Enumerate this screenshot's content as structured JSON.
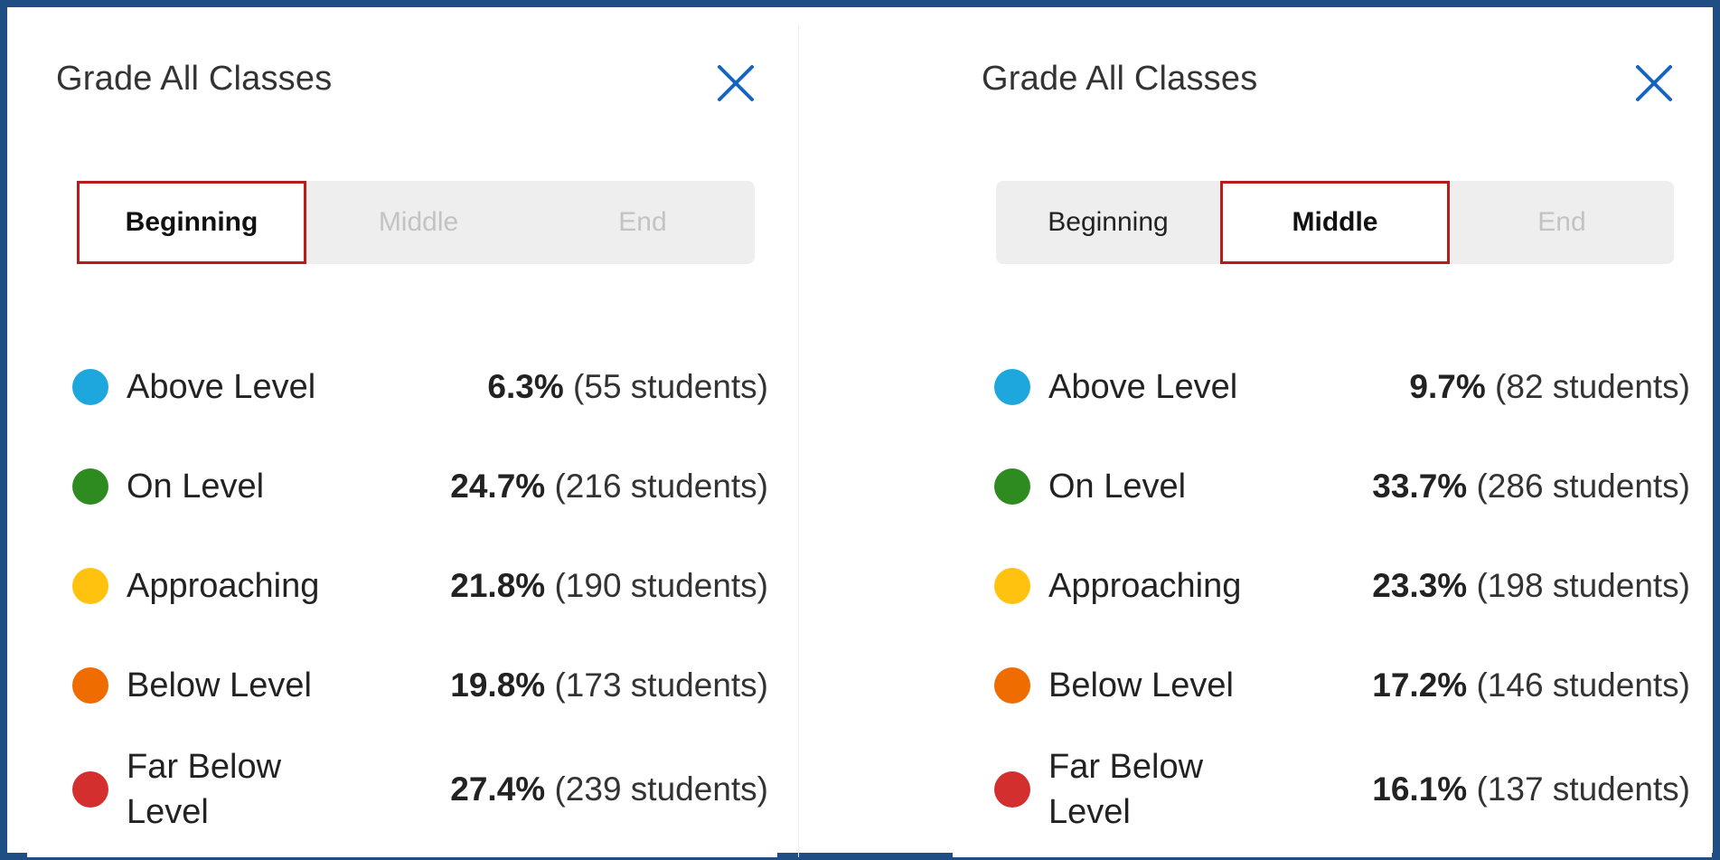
{
  "colors": {
    "above": "#1ea7dc",
    "on": "#2e8b1f",
    "approaching": "#ffc20e",
    "below": "#ef6c00",
    "far_below": "#d32f2f",
    "accent_blue": "#1565c0",
    "highlight_red": "#b71c1c"
  },
  "panels": [
    {
      "title": "Grade All Classes",
      "close_icon": "close-icon",
      "tabs": [
        {
          "label": "Beginning"
        },
        {
          "label": "Middle"
        },
        {
          "label": "End"
        }
      ],
      "active_tab": "Beginning",
      "rows": [
        {
          "label": "Above Level",
          "percent": "6.3%",
          "students": "(55 students)"
        },
        {
          "label": "On Level",
          "percent": "24.7%",
          "students": "(216 students)"
        },
        {
          "label": "Approaching",
          "percent": "21.8%",
          "students": "(190 students)"
        },
        {
          "label": "Below Level",
          "percent": "19.8%",
          "students": "(173 students)"
        },
        {
          "label": "Far Below Level",
          "percent": "27.4%",
          "students": "(239 students)"
        }
      ]
    },
    {
      "title": "Grade All Classes",
      "close_icon": "close-icon",
      "tabs": [
        {
          "label": "Beginning"
        },
        {
          "label": "Middle"
        },
        {
          "label": "End"
        }
      ],
      "active_tab": "Middle",
      "rows": [
        {
          "label": "Above Level",
          "percent": "9.7%",
          "students": "(82 students)"
        },
        {
          "label": "On Level",
          "percent": "33.7%",
          "students": "(286 students)"
        },
        {
          "label": "Approaching",
          "percent": "23.3%",
          "students": "(198 students)"
        },
        {
          "label": "Below Level",
          "percent": "17.2%",
          "students": "(146 students)"
        },
        {
          "label": "Far Below Level",
          "percent": "16.1%",
          "students": "(137 students)"
        }
      ]
    }
  ]
}
